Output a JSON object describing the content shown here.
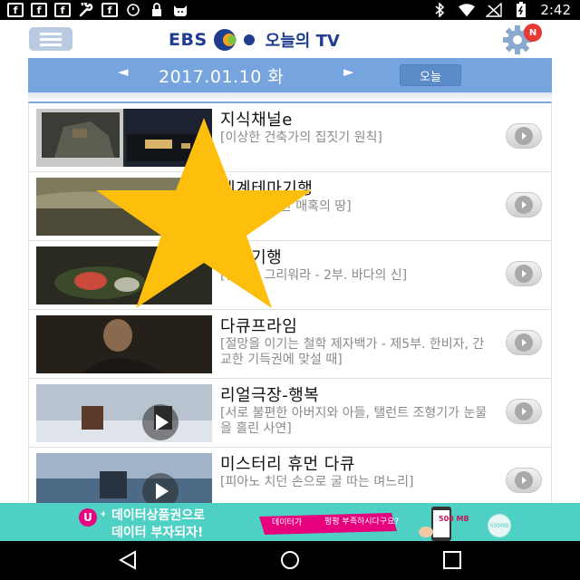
{
  "status_bar": {
    "left_icons": [
      "facebook-icon",
      "facebook-icon",
      "facebook-icon",
      "wrench-icon",
      "facebook-icon",
      "alarm-icon",
      "lock-icon",
      "cat-icon"
    ],
    "fb_letter": "f",
    "time": "2:42",
    "right_icons": [
      "bluetooth-icon",
      "wifi-icon",
      "no-signal-icon",
      "battery-icon"
    ]
  },
  "header": {
    "logo_left": "EBS",
    "logo_right": "오늘의 TV",
    "notification_badge": "N"
  },
  "date_bar": {
    "prev": "◄",
    "date": "2017.01.10 화",
    "next": "►",
    "today_label": "오늘"
  },
  "programs": [
    {
      "title": "지식채널e",
      "desc": "[이상한 건축가의 집짓기 원칙]"
    },
    {
      "title": "세계테마기행",
      "desc": "[몽골, 모험한 매혹의 땅]"
    },
    {
      "title": "한국기행",
      "desc": "[섬으로 그리워라 - 2부. 바다의 신]"
    },
    {
      "title": "다큐프라임",
      "desc": "[절망을 이기는 철학 제자백가 - 제5부. 한비자, 간교한 기득권에 맞설 때]"
    },
    {
      "title": "리얼극장-행복",
      "desc": "[서로 불편한 아버지와 아들, 탤런트 조형기가 눈물을 흘린 사연]"
    },
    {
      "title": "미스터리 휴먼 다큐",
      "desc": "[피아노 치던 손으로 굴 따는 며느리]"
    }
  ],
  "ad": {
    "line1": "데이터상품권으로",
    "line2": "데이터 부자되자!",
    "bubble_line1": "데이터가",
    "bubble_line2": "펑펑 부족하시다구요?",
    "phone_amount": "500 MB",
    "coin_label": "500MB"
  },
  "colors": {
    "date_bar": "#76a4de",
    "logo_blue": "#1e3d8f",
    "star": "#fdbe0c",
    "ad_bg": "#4fd0c4",
    "badge": "#e53935"
  }
}
